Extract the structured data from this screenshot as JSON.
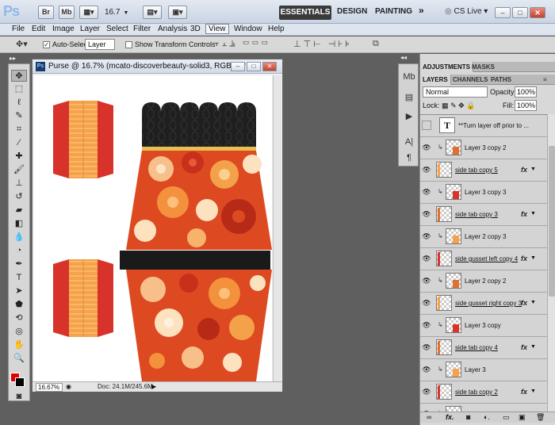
{
  "appbar": {
    "logo": "Ps",
    "bridge_label": "Br",
    "minibridge_label": "Mb",
    "zoom_value": "16.7",
    "workspaces": {
      "essentials": "ESSENTIALS",
      "design": "DESIGN",
      "painting": "PAINTING",
      "more": "»"
    },
    "cslive": "CS Live",
    "window_controls": {
      "minimize": "–",
      "restore": "□",
      "close": "✕"
    }
  },
  "menubar": [
    "File",
    "Edit",
    "Image",
    "Layer",
    "Select",
    "Filter",
    "Analysis",
    "3D",
    "View",
    "Window",
    "Help"
  ],
  "options": {
    "auto_select_label": "Auto-Select:",
    "auto_select_value": "Layer",
    "show_transform_label": "Show Transform Controls"
  },
  "document": {
    "title": "Purse @ 16.7% (mcato-discoverbeauty-solid3, RGB/8) *",
    "zoom": "16.67%",
    "doc_info": "Doc: 24.1M/245.6M"
  },
  "panels": {
    "top_tabs": [
      "ADJUSTMENTS",
      "MASKS"
    ],
    "layer_tabs": [
      "LAYERS",
      "CHANNELS",
      "PATHS"
    ],
    "blend_mode": "Normal",
    "opacity_label": "Opacity:",
    "opacity_value": "100%",
    "lock_label": "Lock:",
    "fill_label": "Fill:",
    "fill_value": "100%"
  },
  "layers": [
    {
      "name": "**Turn layer off prior to ...",
      "type": "text",
      "visible": false,
      "clipped": false,
      "fx": false,
      "underline": false
    },
    {
      "name": "Layer 3 copy 2",
      "type": "raster",
      "visible": true,
      "clipped": true,
      "fx": false,
      "underline": false
    },
    {
      "name": "side tab copy 5",
      "type": "raster",
      "visible": true,
      "clipped": false,
      "fx": true,
      "underline": true
    },
    {
      "name": "Layer 3 copy 3",
      "type": "raster",
      "visible": true,
      "clipped": true,
      "fx": false,
      "underline": false
    },
    {
      "name": "side tab  copy 3",
      "type": "raster",
      "visible": true,
      "clipped": false,
      "fx": true,
      "underline": true
    },
    {
      "name": "Layer 2 copy 3",
      "type": "raster",
      "visible": true,
      "clipped": true,
      "fx": false,
      "underline": false
    },
    {
      "name": "side gusset left copy 4",
      "type": "raster",
      "visible": true,
      "clipped": false,
      "fx": true,
      "underline": true
    },
    {
      "name": "Layer 2 copy 2",
      "type": "raster",
      "visible": true,
      "clipped": true,
      "fx": false,
      "underline": false
    },
    {
      "name": "side gusset right  copy 3",
      "type": "raster",
      "visible": true,
      "clipped": false,
      "fx": true,
      "underline": true
    },
    {
      "name": "Layer 3 copy",
      "type": "raster",
      "visible": true,
      "clipped": true,
      "fx": false,
      "underline": false
    },
    {
      "name": "side tab copy 4",
      "type": "raster",
      "visible": true,
      "clipped": false,
      "fx": true,
      "underline": true
    },
    {
      "name": "Layer 3",
      "type": "raster",
      "visible": true,
      "clipped": true,
      "fx": false,
      "underline": false
    },
    {
      "name": "side tab  copy 2",
      "type": "raster",
      "visible": true,
      "clipped": false,
      "fx": true,
      "underline": true
    },
    {
      "name": "Layer 2 copy",
      "type": "raster",
      "visible": true,
      "clipped": true,
      "fx": false,
      "underline": false
    }
  ],
  "footer_icons": [
    "link-icon",
    "fx-icon",
    "mask-icon",
    "adjustment-icon",
    "group-icon",
    "new-layer-icon",
    "trash-icon"
  ],
  "colors": {
    "foreground": "#e00000",
    "background": "#000000",
    "accent": "#3a3a3a"
  }
}
